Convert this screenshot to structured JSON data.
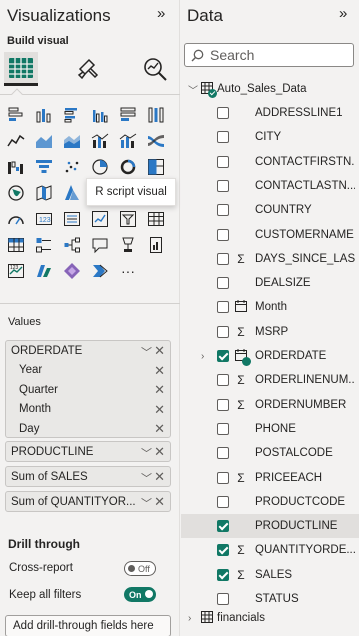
{
  "visualizations": {
    "title": "Visualizations",
    "build_visual_label": "Build visual",
    "tooltip": "R script visual",
    "values_label": "Values",
    "wells": [
      {
        "field": "ORDERDATE",
        "children": [
          "Year",
          "Quarter",
          "Month",
          "Day"
        ]
      },
      {
        "field": "PRODUCTLINE"
      },
      {
        "field": "Sum of SALES"
      },
      {
        "field": "Sum of QUANTITYOR..."
      }
    ],
    "drill_through": {
      "title": "Drill through",
      "cross_report_label": "Cross-report",
      "cross_report_state": "Off",
      "keep_filters_label": "Keep all filters",
      "keep_filters_state": "On",
      "drop_zone": "Add drill-through fields here"
    },
    "python_glyph": "Py",
    "r_glyph": "R",
    "more_glyph": "···"
  },
  "data": {
    "title": "Data",
    "search_placeholder": "Search",
    "table_name": "Auto_Sales_Data",
    "second_table": "financials",
    "fields": [
      {
        "label": "ADDRESSLINE1",
        "icon": "",
        "checked": false
      },
      {
        "label": "CITY",
        "icon": "",
        "checked": false
      },
      {
        "label": "CONTACTFIRSTN...",
        "icon": "",
        "checked": false
      },
      {
        "label": "CONTACTLASTN...",
        "icon": "",
        "checked": false
      },
      {
        "label": "COUNTRY",
        "icon": "",
        "checked": false
      },
      {
        "label": "CUSTOMERNAME",
        "icon": "",
        "checked": false
      },
      {
        "label": "DAYS_SINCE_LAS...",
        "icon": "Σ",
        "checked": false
      },
      {
        "label": "DEALSIZE",
        "icon": "",
        "checked": false
      },
      {
        "label": "Month",
        "icon": "calendar",
        "checked": false
      },
      {
        "label": "MSRP",
        "icon": "Σ",
        "checked": false
      },
      {
        "label": "ORDERDATE",
        "icon": "calendar-hierarchy",
        "checked": true,
        "expandable": true
      },
      {
        "label": "ORDERLINENUM...",
        "icon": "Σ",
        "checked": false
      },
      {
        "label": "ORDERNUMBER",
        "icon": "Σ",
        "checked": false
      },
      {
        "label": "PHONE",
        "icon": "",
        "checked": false
      },
      {
        "label": "POSTALCODE",
        "icon": "",
        "checked": false
      },
      {
        "label": "PRICEEACH",
        "icon": "Σ",
        "checked": false
      },
      {
        "label": "PRODUCTCODE",
        "icon": "",
        "checked": false
      },
      {
        "label": "PRODUCTLINE",
        "icon": "",
        "checked": true,
        "selected": true
      },
      {
        "label": "QUANTITYORDE...",
        "icon": "Σ",
        "checked": true
      },
      {
        "label": "SALES",
        "icon": "Σ",
        "checked": true
      },
      {
        "label": "STATUS",
        "icon": "",
        "checked": false
      }
    ],
    "sigma_glyph": "Σ"
  },
  "colors": {
    "accent": "#117865",
    "pane_bg": "#f3f2f1",
    "well_bg": "#e9e8e6"
  }
}
